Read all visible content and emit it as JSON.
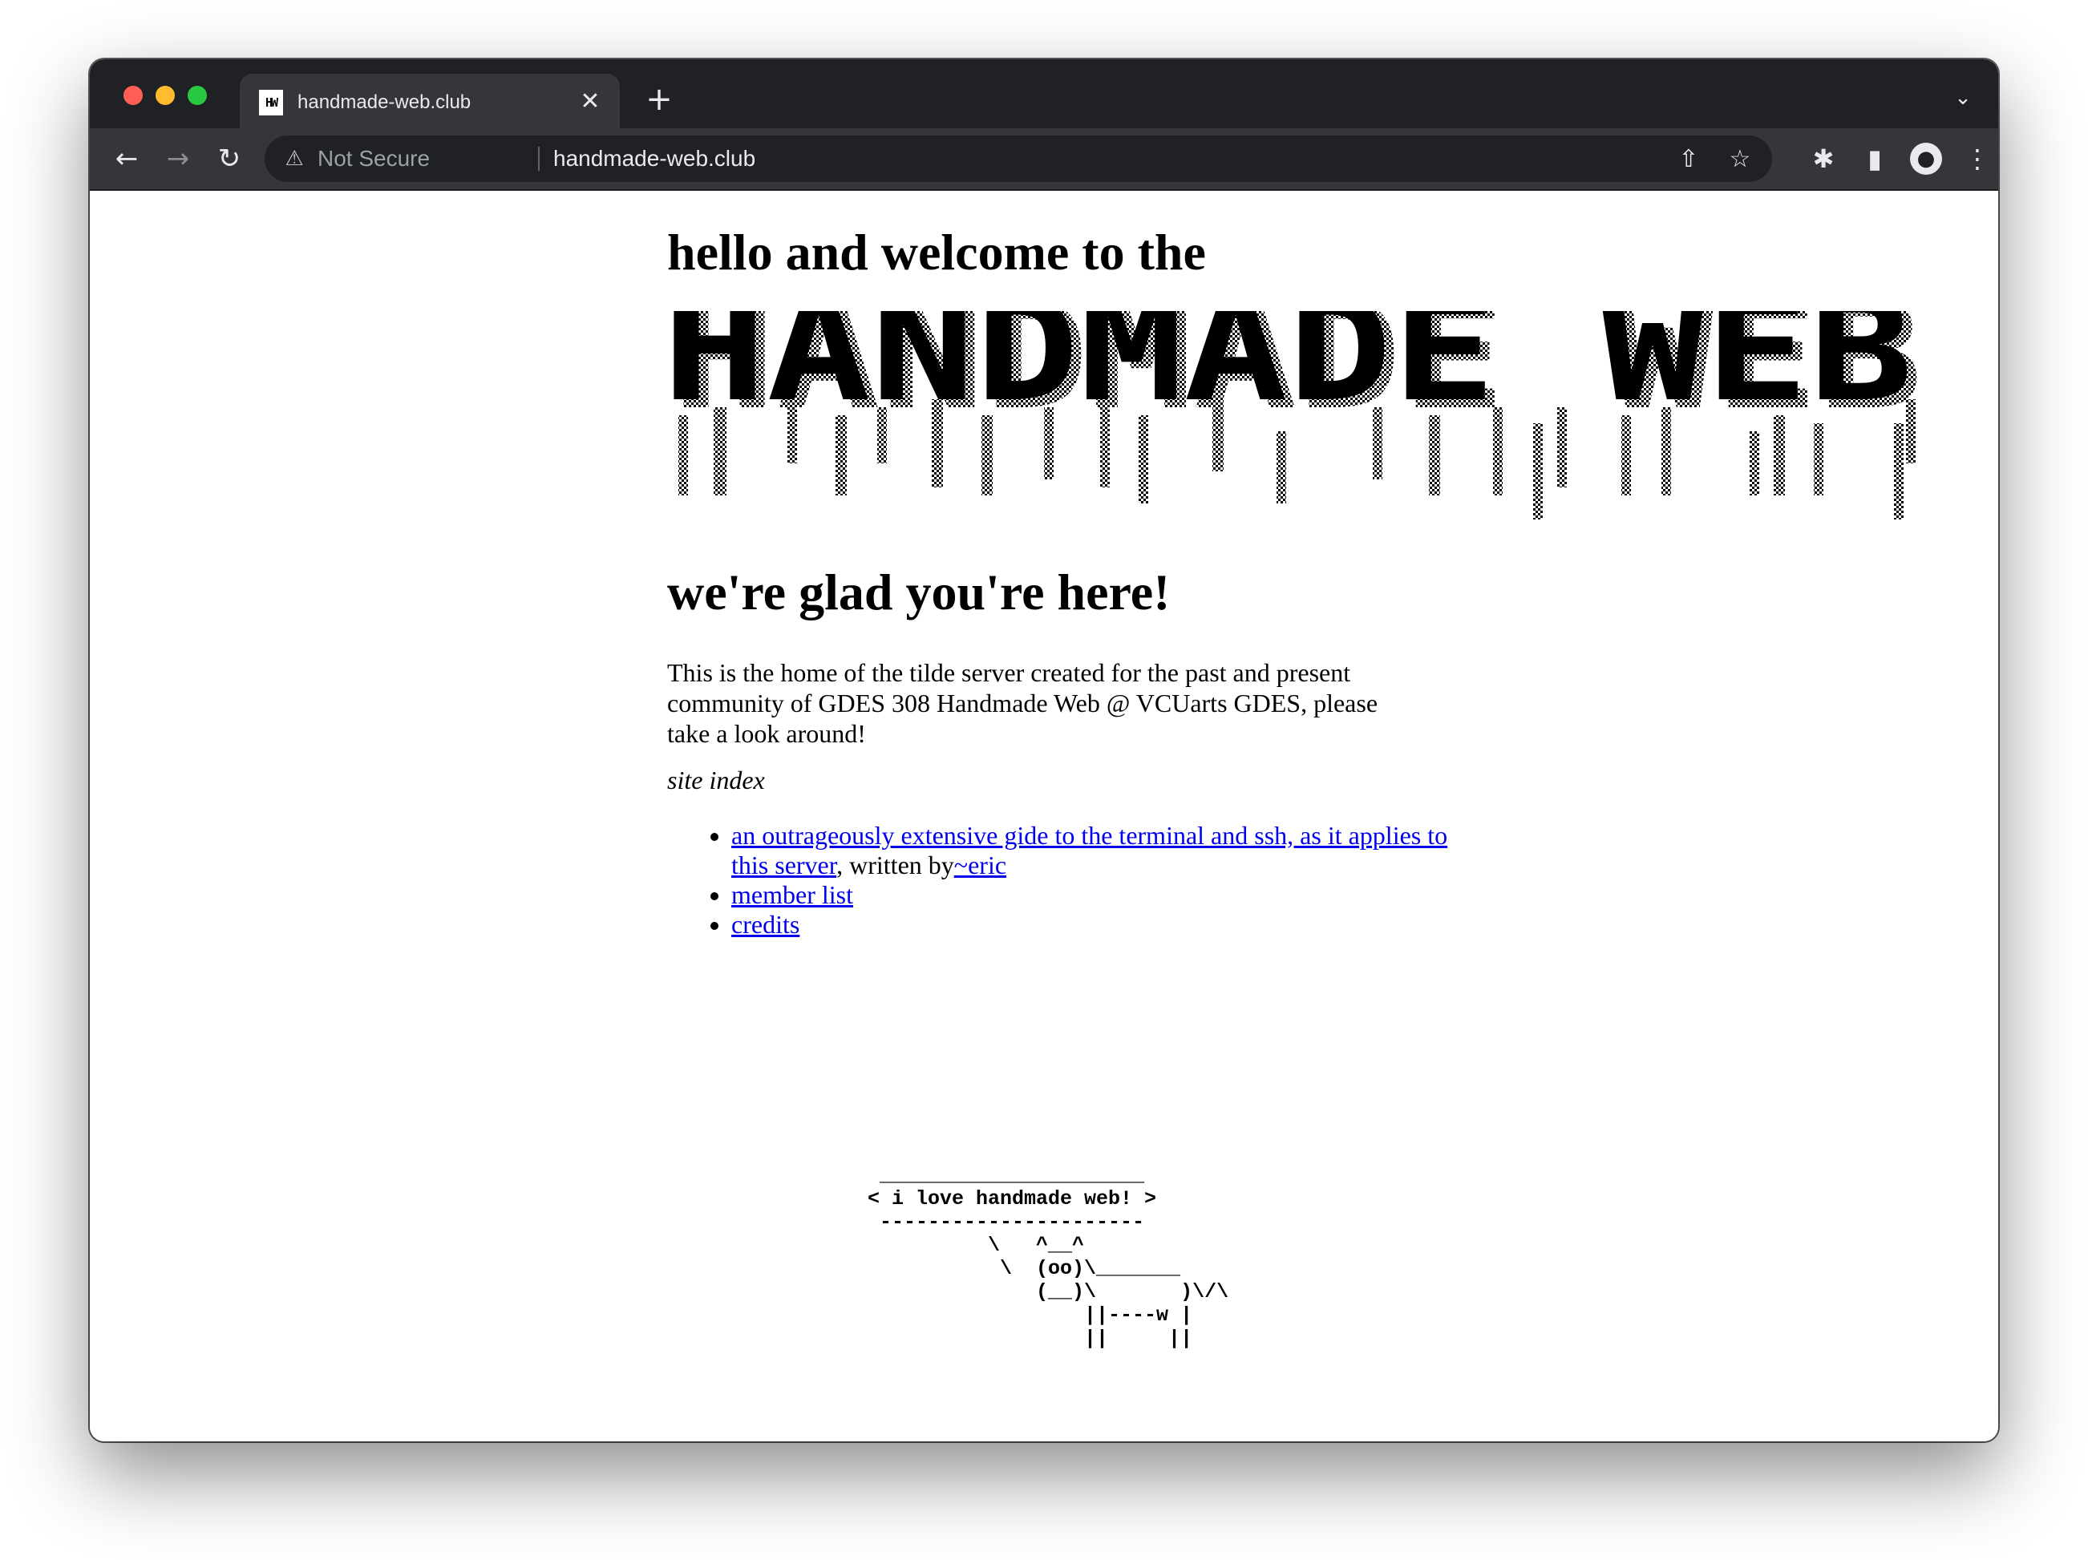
{
  "browser": {
    "tab_title": "handmade-web.club",
    "tab_favicon_text": "HW",
    "tab_close": "✕",
    "new_tab": "+",
    "tab_list": "⌄",
    "security_label": "Not Secure",
    "url": "handmade-web.club",
    "icons": {
      "back": "←",
      "forward": "→",
      "reload": "↻",
      "warning": "⚠",
      "share": "⇧",
      "star": "☆",
      "extensions": "✱",
      "side_panel": "▮",
      "profile": "●",
      "menu": "⋮"
    }
  },
  "page": {
    "heading": "hello and welcome to the",
    "banner_text": "HANDMADE WEB",
    "subheading": "we're glad you're here!",
    "intro": "This is the home of the tilde server created for the past and present community of GDES 308 Handmade Web @ VCUarts GDES, please take a look around!",
    "site_index_label": "site index",
    "links": {
      "guide": "an outrageously extensive gide to the terminal and ssh, as it applies to this server",
      "written_by": ", written by",
      "author": "~eric",
      "members": "member list",
      "credits": "credits"
    },
    "cowsay": " ______________________\n< i love handmade web! >\n ----------------------\n          \\   ^__^\n           \\  (oo)\\_______\n              (__)\\       )\\/\\\n                  ||----w |\n                  ||     ||"
  }
}
